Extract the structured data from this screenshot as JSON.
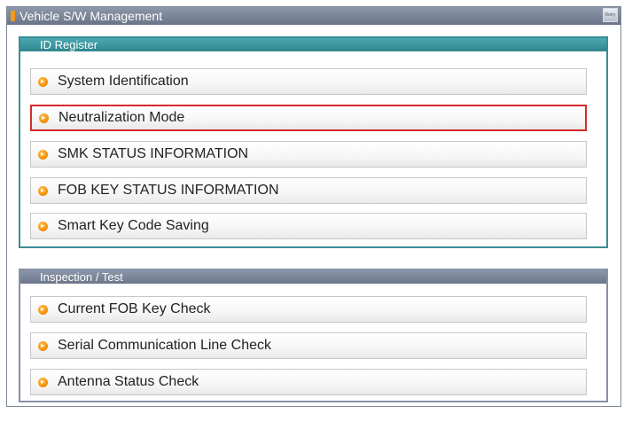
{
  "window": {
    "title": "Vehicle S/W Management",
    "retry_label": "Retry"
  },
  "groups": {
    "id_register": {
      "header": "ID Register",
      "items": [
        {
          "label": "System Identification"
        },
        {
          "label": "Neutralization Mode",
          "selected": true
        },
        {
          "label": "SMK STATUS INFORMATION"
        },
        {
          "label": "FOB KEY STATUS INFORMATION"
        },
        {
          "label": "Smart Key Code Saving"
        }
      ]
    },
    "inspection": {
      "header": "Inspection / Test",
      "items": [
        {
          "label": "Current FOB Key Check"
        },
        {
          "label": "Serial Communication Line Check"
        },
        {
          "label": "Antenna Status Check"
        }
      ]
    }
  },
  "colors": {
    "id_register_accent": "#3a8c95",
    "inspection_accent": "#8891a3",
    "selection_border": "#d42b2b",
    "bullet": "#f08a00"
  },
  "icons": {
    "item_bullet": "orange-arrow-bullet-icon",
    "retry": "retry-icon",
    "title_marker": "orange-bar-icon"
  }
}
